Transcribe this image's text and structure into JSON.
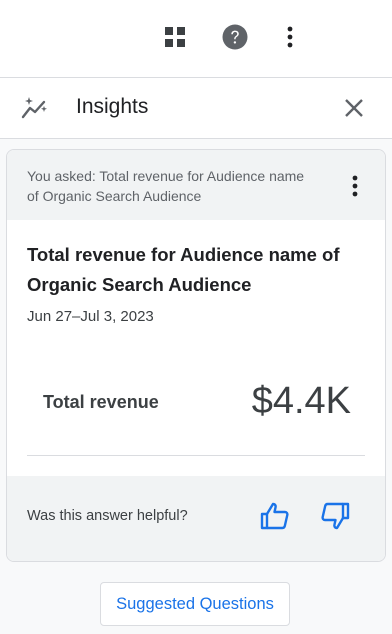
{
  "topbar": {
    "icons": [
      "apps-grid-icon",
      "help-icon",
      "more-vert-icon"
    ]
  },
  "insights": {
    "title": "Insights",
    "icon": "insights-sparkle-icon",
    "close_icon": "close-icon"
  },
  "card": {
    "asked_text": "You asked: Total revenue for Audience name of Organic Search Audience",
    "answer_title": "Total revenue for Audience name of Organic Search Audience",
    "date_range": "Jun 27–Jul 3, 2023",
    "metric_label": "Total revenue",
    "metric_value": "$4.4K",
    "feedback_question": "Was this answer helpful?"
  },
  "suggested_button": "Suggested Questions",
  "colors": {
    "accent": "#1a73e8",
    "icon": "#5f6368",
    "text": "#202124"
  }
}
